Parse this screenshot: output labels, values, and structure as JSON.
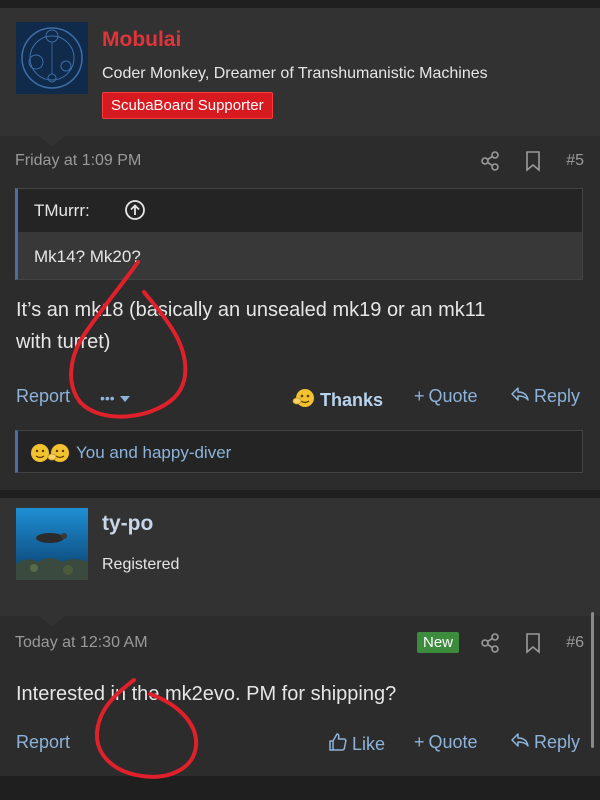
{
  "posts": [
    {
      "username": "Mobulai",
      "user_title": "Coder Monkey, Dreamer of Transhumanistic Machines",
      "banner": "ScubaBoard Supporter",
      "date": "Friday at 1:09 PM",
      "post_number": "#5",
      "quote": {
        "author": "TMurrr:",
        "text": "Mk14? Mk20?"
      },
      "body_lines": [
        "It’s an mk18 (basically an unsealed mk19 or an mk11",
        "with turret)"
      ],
      "actions": {
        "report": "Report",
        "more": "•••",
        "thanks": "Thanks",
        "quote": "Quote",
        "reply": "Reply"
      },
      "reactions": "You and happy-diver"
    },
    {
      "username": "ty-po",
      "user_title": "Registered",
      "date": "Today at 12:30 AM",
      "new_badge": "New",
      "post_number": "#6",
      "body": "Interested in the mk2evo. PM for shipping?",
      "actions": {
        "report": "Report",
        "like": "Like",
        "quote": "Quote",
        "reply": "Reply"
      }
    }
  ],
  "colors": {
    "accent": "#8db3da",
    "username_red": "#e0343a",
    "banner_red": "#d71920",
    "new_green": "#3d8b3d",
    "annotation_red": "#e0202a"
  },
  "icons": [
    "share-icon",
    "bookmark-icon",
    "arrow-up-circle-icon",
    "thanks-emoji-icon",
    "like-icon",
    "reply-icon",
    "caret-down-icon"
  ]
}
